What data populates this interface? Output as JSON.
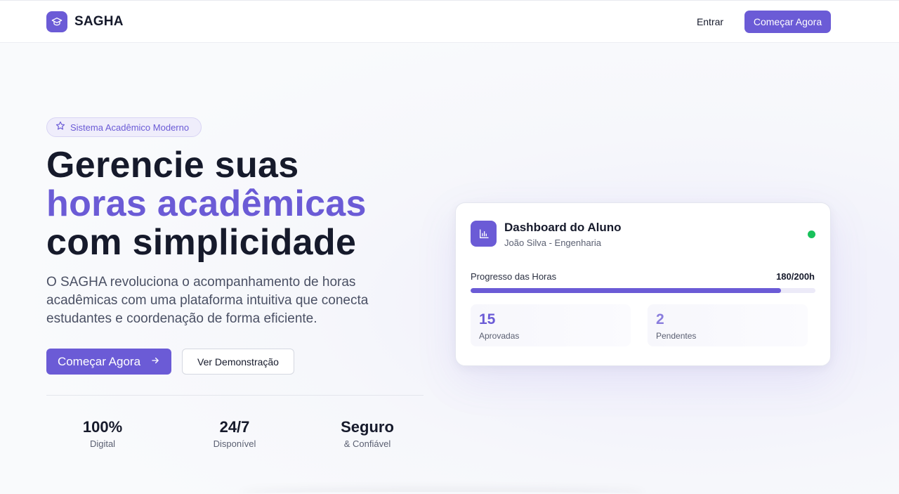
{
  "header": {
    "brand": "SAGHA",
    "login_label": "Entrar",
    "cta_label": "Começar Agora"
  },
  "hero": {
    "badge": "Sistema Acadêmico Moderno",
    "title_line1": "Gerencie suas",
    "title_line2": "horas acadêmicas",
    "title_line3": "com simplicidade",
    "description": "O SAGHA revoluciona o acompanhamento de horas acadêmicas com uma plataforma intuitiva que conecta estudantes e coordenação de forma eficiente.",
    "primary_button": "Começar Agora",
    "secondary_button": "Ver Demonstração"
  },
  "stats": [
    {
      "value": "100%",
      "label": "Digital"
    },
    {
      "value": "24/7",
      "label": "Disponível"
    },
    {
      "value": "Seguro",
      "label": "& Confiável"
    }
  ],
  "dashboard": {
    "title": "Dashboard do Aluno",
    "subtitle": "João Silva - Engenharia",
    "status": "online",
    "progress_label": "Progresso das Horas",
    "progress_value": "180/200h",
    "progress_fraction": 0.9,
    "approved_value": "15",
    "approved_label": "Aprovadas",
    "pending_value": "2",
    "pending_label": "Pendentes"
  },
  "colors": {
    "accent": "#6b5bd6",
    "status_online": "#19c15b",
    "text_dark": "#161a2b"
  },
  "icons": {
    "brand": "graduation-cap-icon",
    "badge": "star-icon",
    "primary_button": "arrow-right-icon",
    "dashboard": "bar-chart-icon"
  }
}
